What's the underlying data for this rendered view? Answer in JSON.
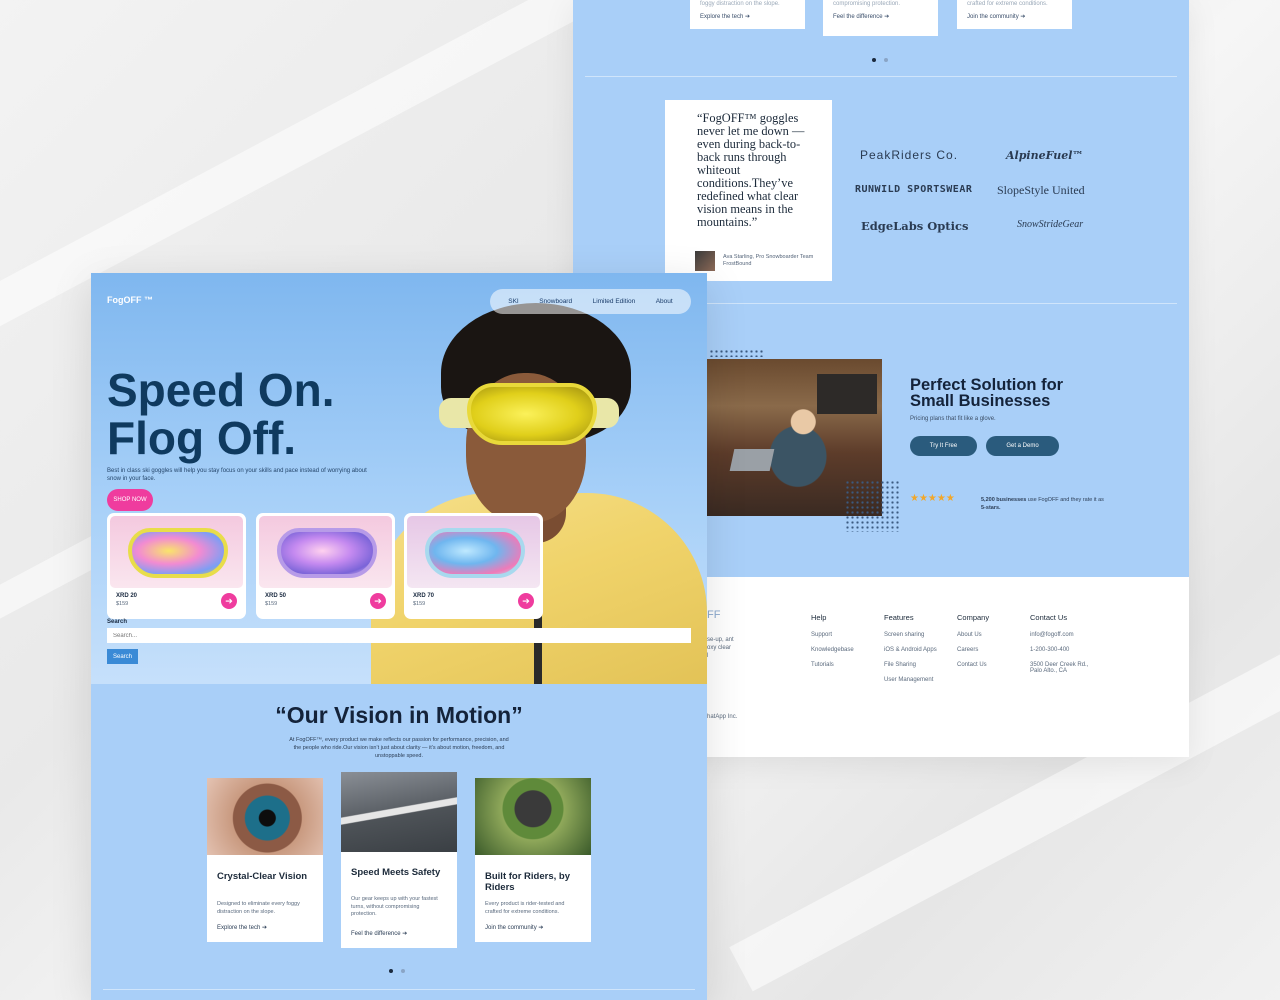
{
  "back_page": {
    "top_cards": [
      {
        "fade": "foggy distraction on the slope.",
        "link": "Explore the tech ➔"
      },
      {
        "fade": "compromising protection.",
        "link": "Feel the difference ➔"
      },
      {
        "fade": "crafted for extreme conditions.",
        "link": "Join the community ➔"
      }
    ],
    "testimonial": {
      "quote": "“FogOFF™ goggles never let me down — even during back-to-back runs through whiteout conditions.They’ve redefined what clear vision means in the mountains.”",
      "author": "Ava Starling, Pro Snowboarder Team FrostBound"
    },
    "partner_logos": [
      "PeakRiders Co.",
      "AlpineFuel™",
      "RUNWILD SPORTSWEAR",
      "SlopeStyle United",
      "EdgeLabs Optics",
      "SnowStrideGear"
    ],
    "business": {
      "title": "Perfect Solution for Small Businesses",
      "subtitle": "Pricing plans that fit like a glove.",
      "try_label": "Try It Free",
      "demo_label": "Get a Demo",
      "stars": "★★★★★",
      "rating_bold": "5,200 businesses",
      "rating_mid": " use FogOFF and they rate it as ",
      "rating_bold2": "5-stars."
    },
    "footer": {
      "brand_fragment": "FF",
      "about_fragment_1": "se-up, ant",
      "about_fragment_2": "oxy clear",
      "about_fragment_3": "l",
      "copyright_fragment": "hatApp Inc.",
      "columns": [
        {
          "heading": "Help",
          "items": [
            "Support",
            "Knowledgebase",
            "Tutorials"
          ]
        },
        {
          "heading": "Features",
          "items": [
            "Screen sharing",
            "iOS & Android Apps",
            "File Sharing",
            "User Management"
          ]
        },
        {
          "heading": "Company",
          "items": [
            "About Us",
            "Careers",
            "Contact Us"
          ]
        },
        {
          "heading": "Contact Us",
          "items": [
            "info@fogoff.com",
            "1-200-300-400",
            "3500 Deer Creek Rd., Palo Alto., CA"
          ]
        }
      ]
    }
  },
  "front_page": {
    "brand": "FogOFF ™",
    "nav": [
      "SKI",
      "Snowboard",
      "Limited Edition",
      "About"
    ],
    "headline_1": "Speed On.",
    "headline_2": "Flog Off.",
    "tagline": "Best in class ski goggles will help you stay focus on your skills and pace instead of worrying about snow in your face.",
    "shop_label": "SHOP NOW",
    "products": [
      {
        "name": "XRD 20",
        "price": "$159"
      },
      {
        "name": "XRD 50",
        "price": "$159"
      },
      {
        "name": "XRD 70",
        "price": "$159"
      }
    ],
    "search": {
      "label": "Search",
      "placeholder": "Search...",
      "button": "Search"
    },
    "vision": {
      "title": "“Our Vision in Motion”",
      "body": "At FogOFF™, every product we make reflects our passion for performance, precision, and the people who ride.Our vision isn’t just about clarity — it’s about motion, freedom, and unstoppable speed."
    },
    "vision_cards": [
      {
        "title": "Crystal-Clear Vision",
        "desc": "Designed to eliminate every foggy distraction on the slope.",
        "link": "Explore the tech ➔"
      },
      {
        "title": "Speed Meets Safety",
        "desc": "Our gear keeps up with your fastest turns, without compromising protection.",
        "link": "Feel the difference ➔"
      },
      {
        "title": "Built for Riders, by Riders",
        "desc": "Every product is rider-tested and crafted for extreme conditions.",
        "link": "Join the community ➔"
      }
    ],
    "icons": {
      "arrow": "arrow-right-icon"
    }
  },
  "colors": {
    "accent_pink": "#ef3c9e",
    "page_blue": "#a9cff8",
    "navy": "#0f3a5f",
    "star": "#f1a72b",
    "button_teal": "#2a5b7d"
  }
}
